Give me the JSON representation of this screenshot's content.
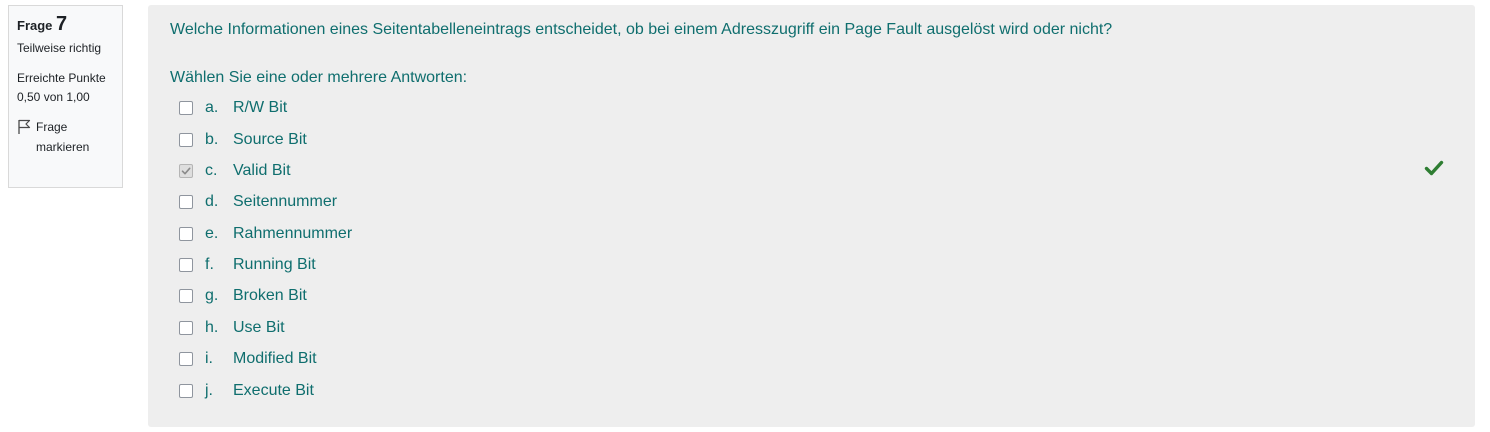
{
  "info": {
    "question_label": "Frage",
    "question_number": "7",
    "state": "Teilweise richtig",
    "grade": "Erreichte Punkte 0,50 von 1,00",
    "flag_label_line1": "Frage",
    "flag_label_line2": "markieren",
    "flag_icon": "flag-icon"
  },
  "question": {
    "text": "Welche Informationen eines Seitentabelleneintrags entscheidet, ob bei einem Adresszugriff ein Page Fault ausgelöst wird oder nicht?",
    "prompt": "Wählen Sie eine oder mehrere Antworten:"
  },
  "answers": [
    {
      "letter": "a.",
      "label": "R/W Bit",
      "checked": false
    },
    {
      "letter": "b.",
      "label": "Source Bit",
      "checked": false
    },
    {
      "letter": "c.",
      "label": "Valid Bit",
      "checked": true,
      "feedback_icon": "check-icon"
    },
    {
      "letter": "d.",
      "label": "Seitennummer",
      "checked": false
    },
    {
      "letter": "e.",
      "label": "Rahmennummer",
      "checked": false
    },
    {
      "letter": "f.",
      "label": "Running Bit",
      "checked": false
    },
    {
      "letter": "g.",
      "label": "Broken Bit",
      "checked": false
    },
    {
      "letter": "h.",
      "label": "Use Bit",
      "checked": false
    },
    {
      "letter": "i.",
      "label": "Modified Bit",
      "checked": false
    },
    {
      "letter": "j.",
      "label": "Execute Bit",
      "checked": false
    }
  ],
  "colors": {
    "text_teal": "#0f6e6e",
    "correct_green": "#2e7d32",
    "panel_bg": "#eeeeee",
    "info_bg": "#f8f9fa"
  }
}
